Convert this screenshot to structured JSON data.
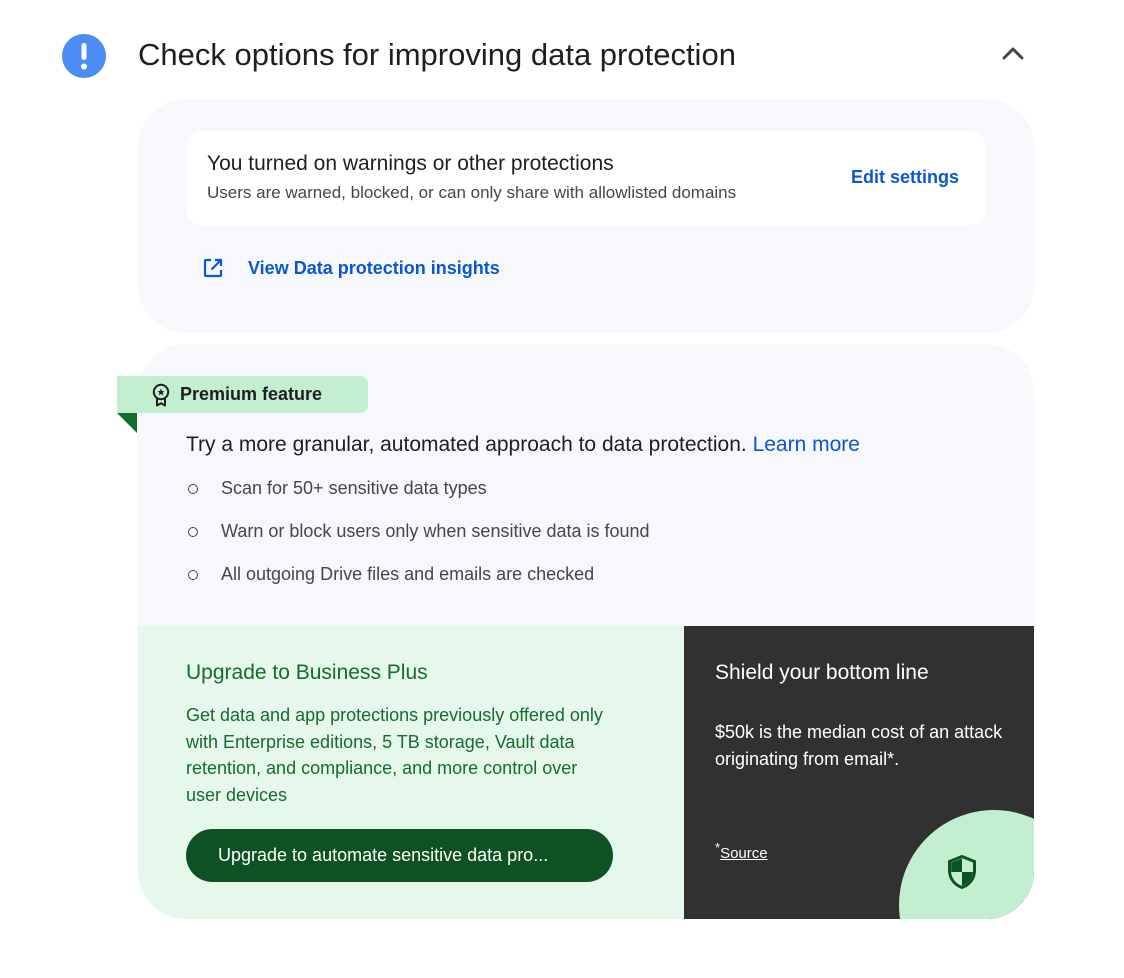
{
  "header": {
    "title": "Check options for improving data protection",
    "alert_icon": "exclamation-icon",
    "collapse_icon": "chevron-up-icon"
  },
  "status_card": {
    "title": "You turned on warnings or other protections",
    "description": "Users are warned, blocked, or can only share with allowlisted domains",
    "action_label": "Edit settings"
  },
  "insights": {
    "label": "View Data protection insights",
    "icon": "open-in-new-icon"
  },
  "premium": {
    "tag_label": "Premium feature",
    "tag_icon": "award-icon",
    "pitch_text": "Try a more granular, automated approach to data protection.",
    "learn_more_label": "Learn more",
    "features": [
      "Scan for 50+ sensitive data types",
      "Warn or block users only when sensitive data is found",
      "All outgoing Drive files and emails are checked"
    ]
  },
  "upgrade": {
    "title": "Upgrade to Business Plus",
    "description": "Get data and app protections previously offered only with Enterprise editions, 5 TB storage, Vault data retention, and compliance, and more control over user devices",
    "button_label": "Upgrade to automate sensitive data pro..."
  },
  "shield": {
    "title": "Shield your bottom line",
    "description": "$50k is the median cost of an attack originating from email*.",
    "source_marker": "*",
    "source_label": "Source",
    "icon": "shield-icon"
  },
  "colors": {
    "link_blue": "#0b57d0",
    "alert_blue": "#4c8df5",
    "premium_green": "#c4eed0",
    "upgrade_bg": "#e6f7ec",
    "upgrade_text": "#146c2e",
    "upgrade_button": "#0e5123",
    "dark_panel": "#313131"
  }
}
